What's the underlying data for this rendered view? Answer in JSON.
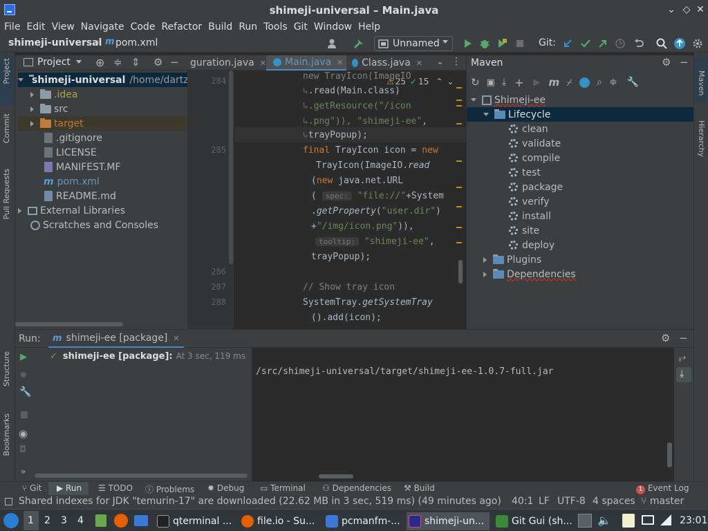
{
  "window": {
    "title": "shimeji-universal – Main.java"
  },
  "menu": [
    "File",
    "Edit",
    "View",
    "Navigate",
    "Code",
    "Refactor",
    "Build",
    "Run",
    "Tools",
    "Git",
    "Window",
    "Help"
  ],
  "navbar": {
    "project": "shimeji-universal",
    "file": "pom.xml",
    "run_config": "Unnamed",
    "git_label": "Git:"
  },
  "left_stripe": [
    "Project",
    "Commit",
    "Pull Requests",
    "Structure",
    "Bookmarks"
  ],
  "right_stripe": [
    "Maven",
    "Hierarchy"
  ],
  "project_panel": {
    "title": "Project",
    "root_name": "shimeji-universal",
    "root_path": "/home/dartz",
    "items": [
      ".idea",
      "src",
      "target",
      ".gitignore",
      "LICENSE",
      "MANIFEST.MF",
      "pom.xml",
      "README.md"
    ],
    "external": "External Libraries",
    "scratches": "Scratches and Consoles"
  },
  "editor": {
    "tabs": [
      "guration.java",
      "Main.java",
      "Class.java"
    ],
    "warnings": "25",
    "ok": "15",
    "line_numbers": [
      "284",
      "285",
      "286",
      "287",
      "288"
    ],
    "code": {
      "l1": "new TrayIcon(ImageIO",
      "l2a": ".read(Main.class)",
      "l3a": ".getResource(\"/icon",
      "l4a": ".png\")), ",
      "l4b": "\"shimeji-ee\"",
      "l4c": ", ",
      "l5a": "trayPopup);",
      "l6_kw": "final",
      "l6_rest": " TrayIcon icon = ",
      "l6_new": "new",
      "l7a": "TrayIcon(ImageIO.",
      "l7b": "read",
      "l8_new": "new",
      "l8_rest": " java.net.URL",
      "l9a": "(",
      "l9_hint": "spec:",
      "l9_str": "\"file://\"",
      "l9_rest": "+System",
      "l10a": ".",
      "l10b": "getProperty",
      "l10c": "(",
      "l10_str": "\"user.dir\"",
      "l10d": ")",
      "l11a": "+",
      "l11_str": "\"/img/icon.png\"",
      "l11b": ")),",
      "l12_hint": "tooltip:",
      "l12_str": "\"shimeji-ee\"",
      "l12b": ",",
      "l13": "trayPopup);",
      "l14": "// Show tray icon",
      "l15a": "SystemTray.",
      "l15b": "getSystemTray",
      "l16": "().add(icon);"
    }
  },
  "maven": {
    "title": "Maven",
    "project": "Shimeji-ee",
    "lifecycle": "Lifecycle",
    "phases": [
      "clean",
      "validate",
      "compile",
      "test",
      "package",
      "verify",
      "install",
      "site",
      "deploy"
    ],
    "plugins": "Plugins",
    "dependencies": "Dependencies"
  },
  "run": {
    "label": "Run:",
    "tab": "shimeji-ee [package]",
    "item_name": "shimeji-ee [package]:",
    "item_time": "At 3 sec, 119 ms",
    "output": "/src/shimeji-universal/target/shimeji-ee-1.0.7-full.jar"
  },
  "tool_tabs": [
    "Git",
    "Run",
    "TODO",
    "Problems",
    "Debug",
    "Terminal",
    "Dependencies",
    "Build"
  ],
  "event_log": {
    "count": "1",
    "label": "Event Log"
  },
  "status": {
    "message": "Shared indexes for JDK \"temurin-17\" are downloaded (22.62 MB in 3 sec, 519 ms) (49 minutes ago)",
    "position": "40:1",
    "line_sep": "LF",
    "encoding": "UTF-8",
    "indent": "4 spaces",
    "branch": "master"
  },
  "taskbar": {
    "desktops": [
      "1",
      "2",
      "3",
      "4"
    ],
    "apps": [
      "qterminal ...",
      "file.io - Su...",
      "pcmanfm-...",
      "shimeji-un...",
      "Git Gui (sh..."
    ],
    "clock": "23:01"
  },
  "colors": {
    "keyword": "#cc7832",
    "string": "#6a8759",
    "comment": "#808080",
    "selection": "#0d293e",
    "accent": "#4a88c7"
  }
}
